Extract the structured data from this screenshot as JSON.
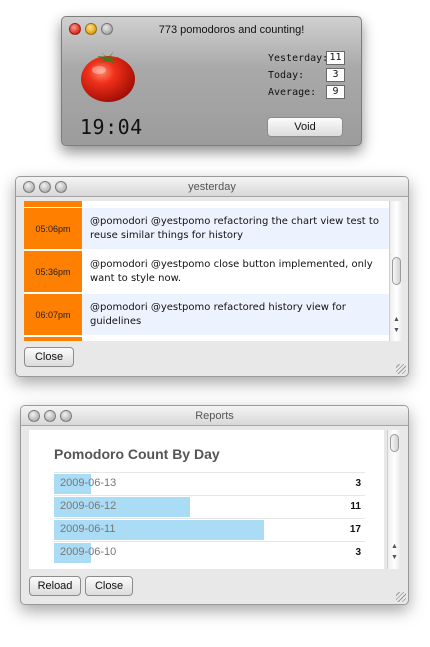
{
  "timer_window": {
    "title": "773 pomodoros and counting!",
    "clock": "19:04",
    "stats": {
      "yesterday_label": "Yesterday:",
      "yesterday_value": "11",
      "today_label": "Today:",
      "today_value": "3",
      "average_label": "Average:",
      "average_value": "9"
    },
    "void_label": "Void"
  },
  "yesterday_window": {
    "title": "yesterday",
    "entries": [
      {
        "time": "",
        "text": ""
      },
      {
        "time": "05:06pm",
        "text": "@pomodori @yestpomo refactoring the chart view test to reuse similar things for history"
      },
      {
        "time": "05:36pm",
        "text": "@pomodori @yestpomo close button implemented, only want to style now."
      },
      {
        "time": "06:07pm",
        "text": "@pomodori @yestpomo refactored history view for guidelines"
      },
      {
        "time": "",
        "text": ""
      }
    ],
    "close_label": "Close"
  },
  "reports_window": {
    "title": "Reports",
    "heading": "Pomodoro Count By Day",
    "chart_data": {
      "type": "bar",
      "title": "Pomodoro Count By Day",
      "categories": [
        "2009-06-13",
        "2009-06-12",
        "2009-06-11",
        "2009-06-10"
      ],
      "values": [
        3,
        11,
        17,
        3
      ],
      "orientation": "horizontal"
    },
    "reload_label": "Reload",
    "close_label": "Close"
  },
  "colors": {
    "time_cell": "#ff7f00",
    "bar_fill": "#aadcf6",
    "alt_row": "#edf3fe"
  }
}
